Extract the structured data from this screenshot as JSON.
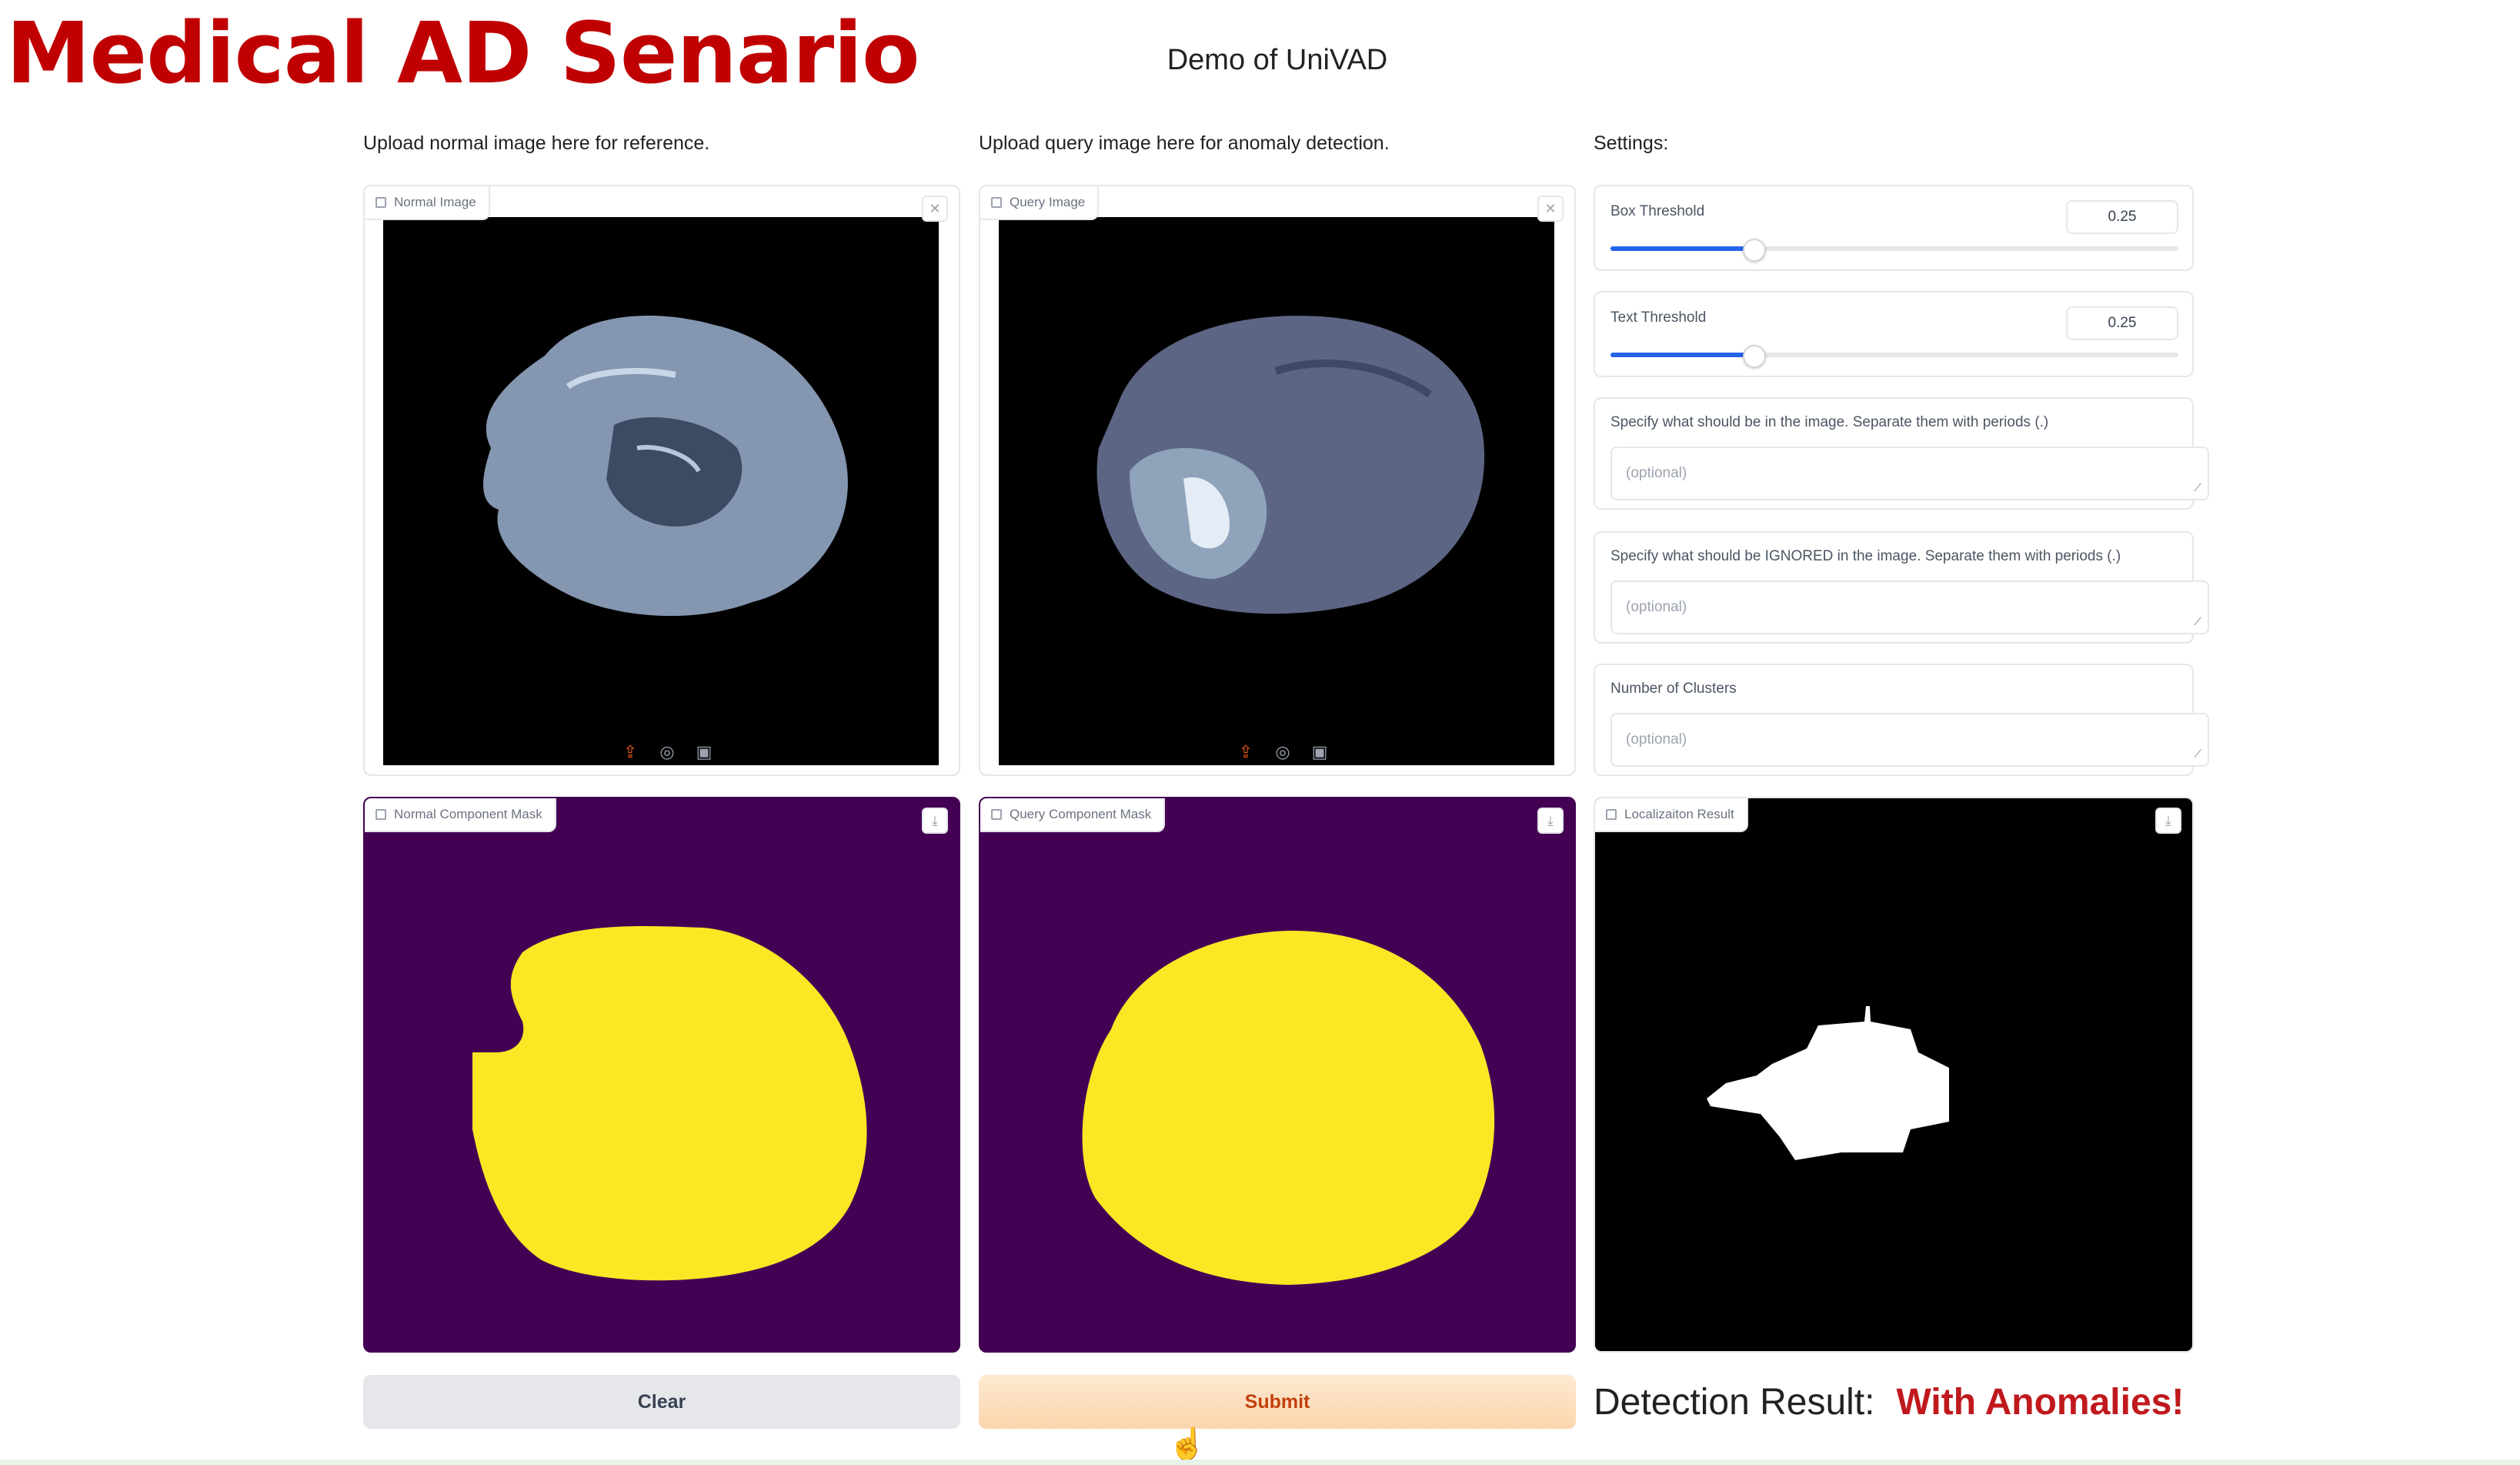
{
  "overlay_title": "Medical AD Senario",
  "app_title": "Demo of UniVAD",
  "columns": {
    "normal_label": "Upload normal image here for reference.",
    "query_label": "Upload query image here for anomaly detection.",
    "settings_label": "Settings:"
  },
  "panels": {
    "normal_image": "Normal Image",
    "query_image": "Query Image",
    "normal_mask": "Normal Component Mask",
    "query_mask": "Query Component Mask",
    "localization": "Localizaiton Result"
  },
  "settings": {
    "box_threshold": {
      "label": "Box Threshold",
      "value": "0.25",
      "level": 0.25
    },
    "text_threshold": {
      "label": "Text Threshold",
      "value": "0.25",
      "level": 0.25
    },
    "include_prompt": {
      "label": "Specify what should be in the image. Separate them with periods (.)",
      "placeholder": "(optional)"
    },
    "ignore_prompt": {
      "label": "Specify what should be IGNORED in the image. Separate them with periods (.)",
      "placeholder": "(optional)"
    },
    "clusters": {
      "label": "Number of Clusters",
      "placeholder": "(optional)"
    }
  },
  "buttons": {
    "clear": "Clear",
    "submit": "Submit"
  },
  "result": {
    "label": "Detection Result:",
    "value": "With Anomalies!"
  },
  "colors": {
    "overlay_title": "#c00000",
    "mask_bg": "#440154",
    "mask_fg": "#fde725",
    "submit_bg": "#fde1c2",
    "submit_text": "#c2410c",
    "result_value": "#c0191d",
    "slider_fill": "#2563eb"
  },
  "icons": {
    "upload": "upload-icon",
    "webcam": "webcam-icon",
    "clipboard": "clipboard-icon",
    "close": "close-icon",
    "download": "download-icon",
    "image": "image-icon"
  }
}
